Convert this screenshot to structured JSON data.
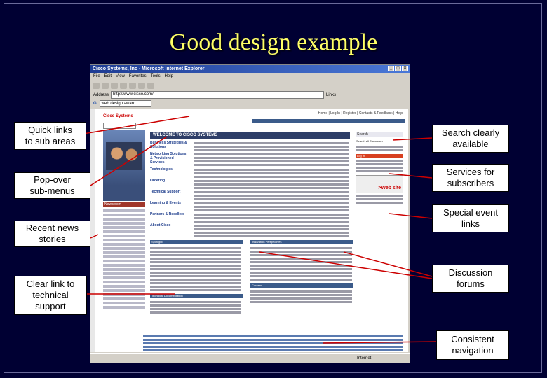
{
  "slide": {
    "title": "Good design example"
  },
  "browser": {
    "title": "Cisco Systems, Inc - Microsoft Internet Explorer",
    "menu": [
      "File",
      "Edit",
      "View",
      "Favorites",
      "Tools",
      "Help"
    ],
    "address_label": "Address",
    "address_value": "http://www.cisco.com/",
    "links_label": "Links",
    "google_query": "web design award",
    "status_internet": "Internet",
    "page": {
      "logo": "Cisco Systems",
      "top_links": "Home | Log In | Register | Contacts & Feedback | Help",
      "welcome": "WELCOME TO CISCO SYSTEMS",
      "news_head": "Newsroom",
      "sections": [
        "Business Strategies & Solutions",
        "Networking Solutions & Provisioned Services",
        "Technologies",
        "Ordering",
        "Technical Support",
        "Learning & Events",
        "Partners & Resellers",
        "About Cisco"
      ],
      "right": {
        "search_label": "Search",
        "search_value": "Search all Cisco.com",
        "login_label": "Log In",
        "ad_text": ">Web site"
      },
      "lower_heads": [
        "Spotlight",
        "Innovation Perspectives",
        "Technical Documentation",
        "Careers"
      ]
    }
  },
  "callouts": {
    "quick_links": "Quick links\nto sub areas",
    "popover": "Pop-over\nsub-menus",
    "recent_news": "Recent news\nstories",
    "tech_support": "Clear link to\ntechnical\nsupport",
    "search": "Search clearly\navailable",
    "subscribers": "Services for\nsubscribers",
    "special_event": "Special event\nlinks",
    "discussion": "Discussion\nforums",
    "navigation": "Consistent\nnavigation"
  },
  "colors": {
    "background": "#000033",
    "title": "#ffff66",
    "arrow": "#cc0000"
  }
}
